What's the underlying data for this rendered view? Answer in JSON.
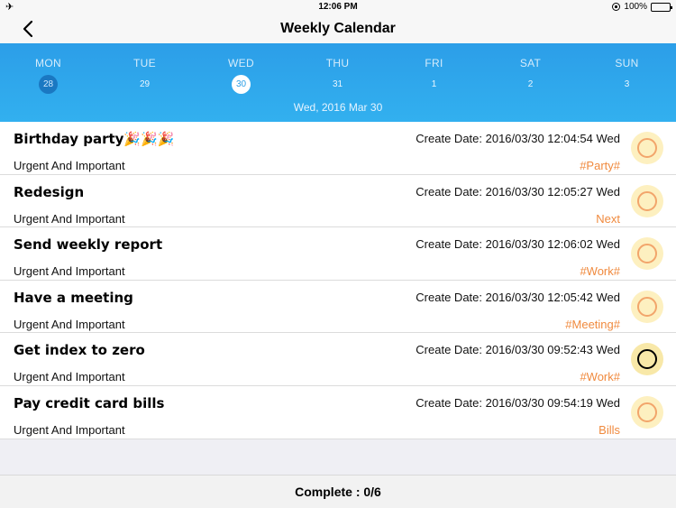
{
  "status_bar": {
    "time": "12:06 PM",
    "battery": "100%",
    "icons": [
      "airplane-icon",
      "rotation-lock-icon",
      "battery-icon"
    ]
  },
  "nav": {
    "title": "Weekly Calendar",
    "back_icon": "chevron-left-icon"
  },
  "week": {
    "days": [
      {
        "name": "MON",
        "num": "28",
        "state": "today"
      },
      {
        "name": "TUE",
        "num": "29",
        "state": ""
      },
      {
        "name": "WED",
        "num": "30",
        "state": "selected"
      },
      {
        "name": "THU",
        "num": "31",
        "state": ""
      },
      {
        "name": "FRI",
        "num": "1",
        "state": ""
      },
      {
        "name": "SAT",
        "num": "2",
        "state": ""
      },
      {
        "name": "SUN",
        "num": "3",
        "state": ""
      }
    ],
    "selected_date": "Wed, 2016 Mar 30"
  },
  "tasks": [
    {
      "title": "Birthday party🎉🎉🎉",
      "priority": "Urgent And Important",
      "created": "Create Date: 2016/03/30 12:04:54 Wed",
      "tag": "#Party#",
      "check": "pending"
    },
    {
      "title": "Redesign",
      "priority": "Urgent And Important",
      "created": "Create Date: 2016/03/30 12:05:27 Wed",
      "tag": "Next",
      "check": "pending"
    },
    {
      "title": "Send weekly report",
      "priority": "Urgent And Important",
      "created": "Create Date: 2016/03/30 12:06:02 Wed",
      "tag": "#Work#",
      "check": "pending"
    },
    {
      "title": "Have a meeting",
      "priority": "Urgent And Important",
      "created": "Create Date: 2016/03/30 12:05:42 Wed",
      "tag": "#Meeting#",
      "check": "pending"
    },
    {
      "title": "Get index to zero",
      "priority": "Urgent And Important",
      "created": "Create Date: 2016/03/30 09:52:43 Wed",
      "tag": "#Work#",
      "check": "active"
    },
    {
      "title": "Pay credit card bills",
      "priority": "Urgent And Important",
      "created": "Create Date: 2016/03/30 09:54:19 Wed",
      "tag": "Bills",
      "check": "pending"
    }
  ],
  "footer": {
    "complete_label": "Complete : 0/6"
  },
  "colors": {
    "header_top": "#2c9ee8",
    "header_bottom": "#32b0ef",
    "tag": "#f08a3e",
    "today_circle": "#1a78c2",
    "check_fill": "#fdf0c0",
    "check_ring": "#f2a56b"
  }
}
